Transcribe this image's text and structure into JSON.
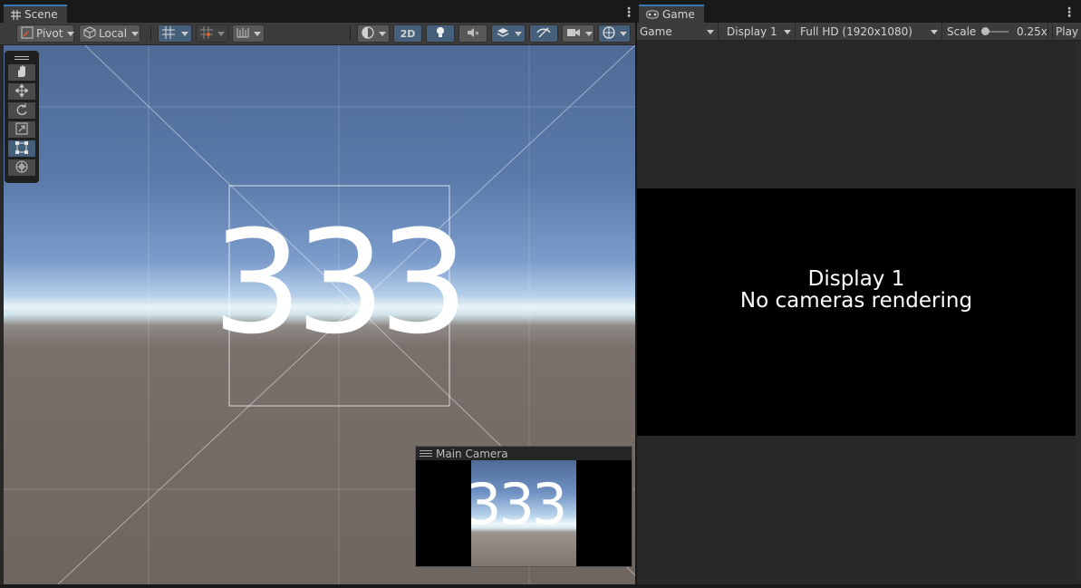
{
  "scene": {
    "tab_label": "Scene",
    "pivot_label": "Pivot",
    "local_label": "Local",
    "mode_2d_label": "2D",
    "view_text": "333",
    "camera_preview": {
      "title": "Main Camera",
      "text": "333"
    },
    "tools": [
      "hand-tool",
      "move-tool",
      "rotate-tool",
      "scale-tool",
      "rect-tool",
      "transform-tool"
    ],
    "active_tool": "rect-tool"
  },
  "game": {
    "tab_label": "Game",
    "view_dropdown": "Game",
    "display_dropdown": "Display 1",
    "resolution_dropdown": "Full HD (1920x1080)",
    "scale_label": "Scale",
    "scale_value": "0.25x",
    "play_label": "Play",
    "message_line1": "Display 1",
    "message_line2": "No cameras rendering"
  },
  "colors": {
    "accent_blue": "#3a79bb",
    "active_button": "#46607c",
    "panel_bg": "#282828",
    "toolbar_bg": "#3c3c3c"
  }
}
